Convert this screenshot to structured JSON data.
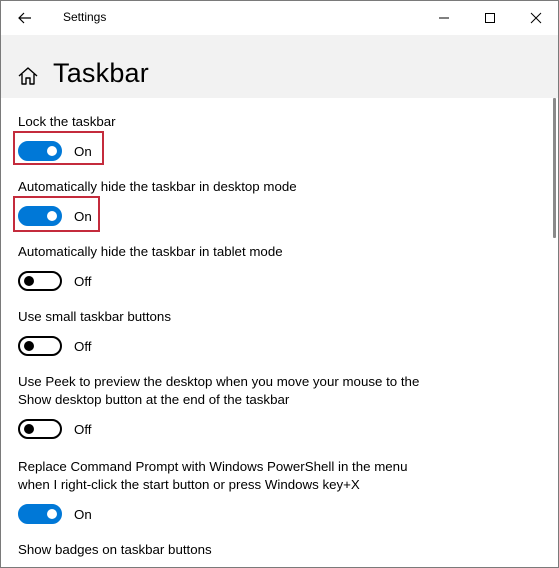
{
  "window": {
    "title": "Settings"
  },
  "header": {
    "page_title": "Taskbar"
  },
  "settings": [
    {
      "label": "Lock the taskbar",
      "state": "On"
    },
    {
      "label": "Automatically hide the taskbar in desktop mode",
      "state": "On"
    },
    {
      "label": "Automatically hide the taskbar in tablet mode",
      "state": "Off"
    },
    {
      "label": "Use small taskbar buttons",
      "state": "Off"
    },
    {
      "label": "Use Peek to preview the desktop when you move your mouse to the Show desktop button at the end of the taskbar",
      "label_line1": "Use Peek to preview the desktop when you move your mouse to the",
      "label_line2": "Show desktop button at the end of the taskbar",
      "state": "Off"
    },
    {
      "label": "Replace Command Prompt with Windows PowerShell in the menu when I right-click the start button or press Windows key+X",
      "label_line1": "Replace Command Prompt with Windows PowerShell in the menu",
      "label_line2": "when I right-click the start button or press Windows key+X",
      "state": "On"
    },
    {
      "label": "Show badges on taskbar buttons"
    }
  ],
  "colors": {
    "accent": "#0078d7",
    "highlight_box": "#c42b3c",
    "header_bg": "#f2f2f2"
  },
  "icons": {
    "back": "back-arrow-icon",
    "home": "home-icon",
    "minimize": "minimize-icon",
    "maximize": "maximize-icon",
    "close": "close-icon"
  }
}
